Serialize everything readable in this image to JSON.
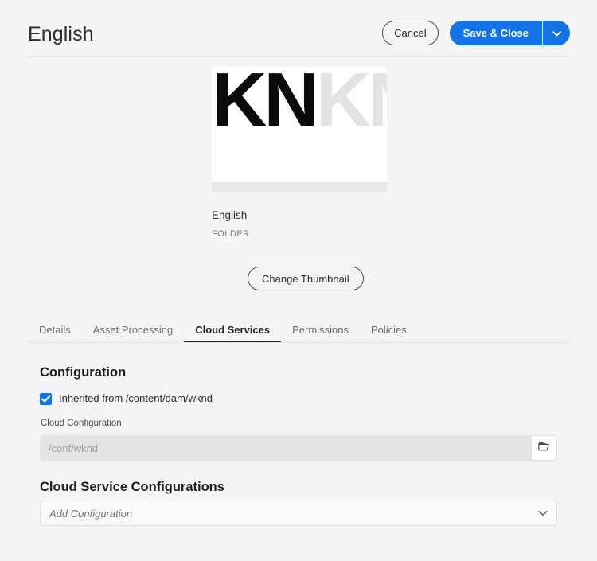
{
  "header": {
    "title": "English",
    "cancel_label": "Cancel",
    "save_label": "Save & Close",
    "save_more_icon": "chevron-down-icon",
    "accent_color": "#1473E6"
  },
  "asset": {
    "thumbnail_text": "KNKNKNKN",
    "thumbnail_dark_text": "KN",
    "name": "English",
    "type": "FOLDER",
    "change_thumbnail_label": "Change Thumbnail"
  },
  "tabs": [
    {
      "label": "Details",
      "active": false
    },
    {
      "label": "Asset Processing",
      "active": false
    },
    {
      "label": "Cloud Services",
      "active": true
    },
    {
      "label": "Permissions",
      "active": false
    },
    {
      "label": "Policies",
      "active": false
    }
  ],
  "configuration": {
    "heading": "Configuration",
    "inherited_checkbox": {
      "label": "Inherited from /content/dam/wknd",
      "checked": true,
      "check_glyph": "✓"
    },
    "cloud_configuration": {
      "label": "Cloud Configuration",
      "value": "/conf/wknd",
      "placeholder": "/conf/wknd",
      "disabled": true,
      "browse_icon": "folder-open-icon"
    }
  },
  "cloud_service_configurations": {
    "heading": "Cloud Service Configurations",
    "dropdown": {
      "value": "Add Configuration",
      "placeholder": "Add Configuration",
      "chevron_icon": "chevron-down-icon"
    }
  }
}
